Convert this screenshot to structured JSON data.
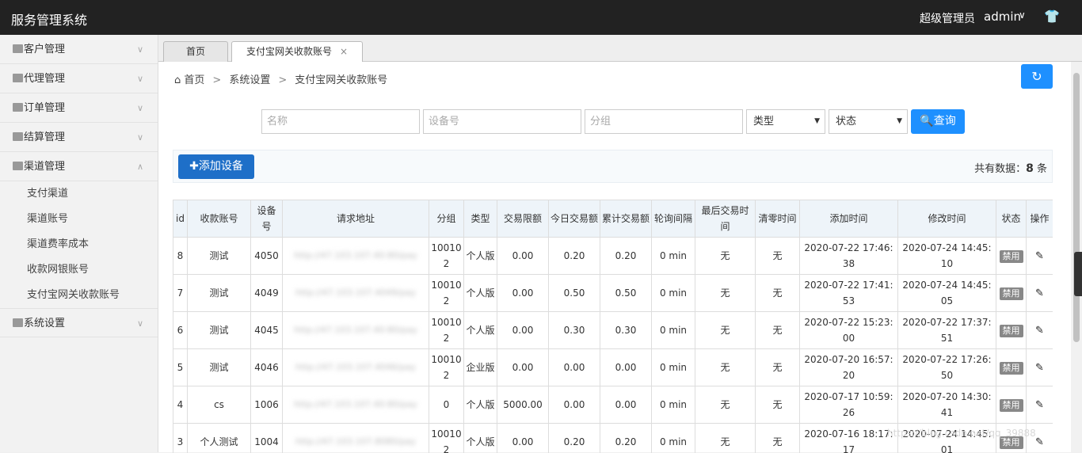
{
  "app": {
    "title": "服务管理系统"
  },
  "user": {
    "role": "超级管理员",
    "name": "admin"
  },
  "sidebar": {
    "menus": [
      {
        "label": "客户管理"
      },
      {
        "label": "代理管理"
      },
      {
        "label": "订单管理"
      },
      {
        "label": "结算管理"
      },
      {
        "label": "渠道管理"
      },
      {
        "label": "系统设置"
      }
    ],
    "channel_sub": [
      "支付渠道",
      "渠道账号",
      "渠道费率成本",
      "收款网银账号",
      "支付宝网关收款账号"
    ]
  },
  "tabs": {
    "home": "首页",
    "active": "支付宝网关收款账号",
    "close": "×"
  },
  "breadcrumb": {
    "home": "首页",
    "sep": ">",
    "level1": "系统设置",
    "level2": "支付宝网关收款账号"
  },
  "filters": {
    "name_placeholder": "名称",
    "device_placeholder": "设备号",
    "group_placeholder": "分组",
    "type_select": "类型",
    "status_select": "状态",
    "search_btn": "查询"
  },
  "toolbar": {
    "add_btn": "添加设备",
    "total_prefix": "共有数据：",
    "total_count": "8",
    "total_suffix": " 条"
  },
  "table": {
    "headers": [
      "id",
      "收款账号",
      "设备号",
      "请求地址",
      "分组",
      "类型",
      "交易限额",
      "今日交易额",
      "累计交易额",
      "轮询间隔",
      "最后交易时间",
      "清零时间",
      "添加时间",
      "修改时间",
      "状态",
      "操作"
    ],
    "rows": [
      {
        "id": "8",
        "account": "测试",
        "device": "4050",
        "url": "http://47.103.107.40:80/pay",
        "group": "100102",
        "type": "个人版",
        "limit": "0.00",
        "today": "0.20",
        "total": "0.20",
        "interval": "0 min",
        "last": "无",
        "reset": "无",
        "added": "2020-07-22 17:46:38",
        "modified": "2020-07-24 14:45:10",
        "status": "禁用"
      },
      {
        "id": "7",
        "account": "测试",
        "device": "4049",
        "url": "http://47.103.107.4049/pay",
        "group": "100102",
        "type": "个人版",
        "limit": "0.00",
        "today": "0.50",
        "total": "0.50",
        "interval": "0 min",
        "last": "无",
        "reset": "无",
        "added": "2020-07-22 17:41:53",
        "modified": "2020-07-24 14:45:05",
        "status": "禁用"
      },
      {
        "id": "6",
        "account": "测试",
        "device": "4045",
        "url": "http://47.103.107.40:80/pay",
        "group": "100102",
        "type": "个人版",
        "limit": "0.00",
        "today": "0.30",
        "total": "0.30",
        "interval": "0 min",
        "last": "无",
        "reset": "无",
        "added": "2020-07-22 15:23:00",
        "modified": "2020-07-22 17:37:51",
        "status": "禁用"
      },
      {
        "id": "5",
        "account": "测试",
        "device": "4046",
        "url": "http://47.103.107.4046/pay",
        "group": "100102",
        "type": "企业版",
        "limit": "0.00",
        "today": "0.00",
        "total": "0.00",
        "interval": "0 min",
        "last": "无",
        "reset": "无",
        "added": "2020-07-20 16:57:20",
        "modified": "2020-07-22 17:26:50",
        "status": "禁用"
      },
      {
        "id": "4",
        "account": "cs",
        "device": "1006",
        "url": "http://47.103.107.40:80/pay",
        "group": "0",
        "type": "个人版",
        "limit": "5000.00",
        "today": "0.00",
        "total": "0.00",
        "interval": "0 min",
        "last": "无",
        "reset": "无",
        "added": "2020-07-17 10:59:26",
        "modified": "2020-07-20 14:30:41",
        "status": "禁用"
      },
      {
        "id": "3",
        "account": "个人测试",
        "device": "1004",
        "url": "http://47.103.107.8080/pay",
        "group": "100102",
        "type": "个人版",
        "limit": "0.00",
        "today": "0.20",
        "total": "0.20",
        "interval": "0 min",
        "last": "无",
        "reset": "无",
        "added": "2020-07-16 18:17:17",
        "modified": "2020-07-24 14:45:01",
        "status": "禁用"
      }
    ]
  },
  "watermark": "https://blog.csdn.net/qq_39888"
}
